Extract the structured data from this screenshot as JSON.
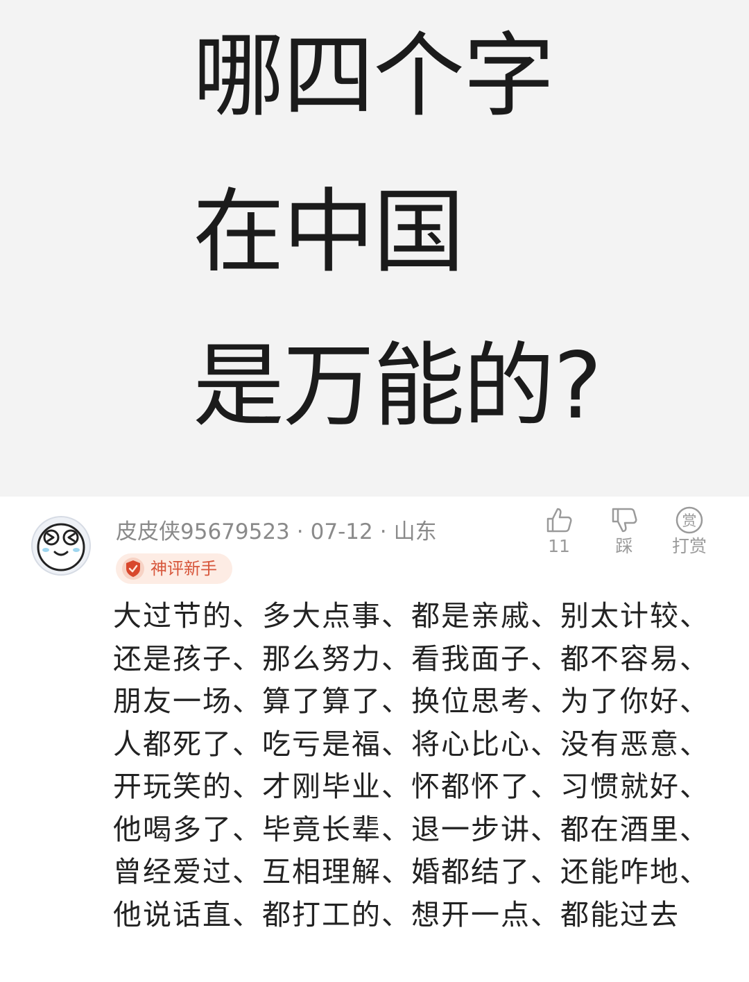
{
  "question": {
    "lines": [
      "哪四个字",
      "在中国",
      "是万能的?"
    ]
  },
  "comment": {
    "username": "皮皮侠95679523",
    "date": "07-12",
    "location": "山东",
    "separator": "·",
    "badge": "神评新手",
    "actions": {
      "like_count": "11",
      "dislike_label": "踩",
      "reward_label": "打赏",
      "reward_icon_char": "赏"
    },
    "text": "大过节的、多大点事、都是亲戚、别太计较、还是孩子、那么努力、看我面子、都不容易、朋友一场、算了算了、换位思考、为了你好、人都死了、吃亏是福、将心比心、没有恶意、开玩笑的、才刚毕业、怀都怀了、习惯就好、他喝多了、毕竟长辈、退一步讲、都在酒里、曾经爱过、互相理解、婚都结了、还能咋地、他说话直、都打工的、想开一点、都能过去"
  },
  "colors": {
    "banner_bg": "#f3f3f3",
    "badge_bg": "#fdece4",
    "badge_text": "#d7563b",
    "meta_text": "#8a8a8a"
  },
  "icons": {
    "avatar": "smiling-face-avatar",
    "like": "thumbs-up-icon",
    "dislike": "thumbs-down-icon",
    "reward": "reward-coin-icon",
    "badge": "shield-badge-icon"
  }
}
